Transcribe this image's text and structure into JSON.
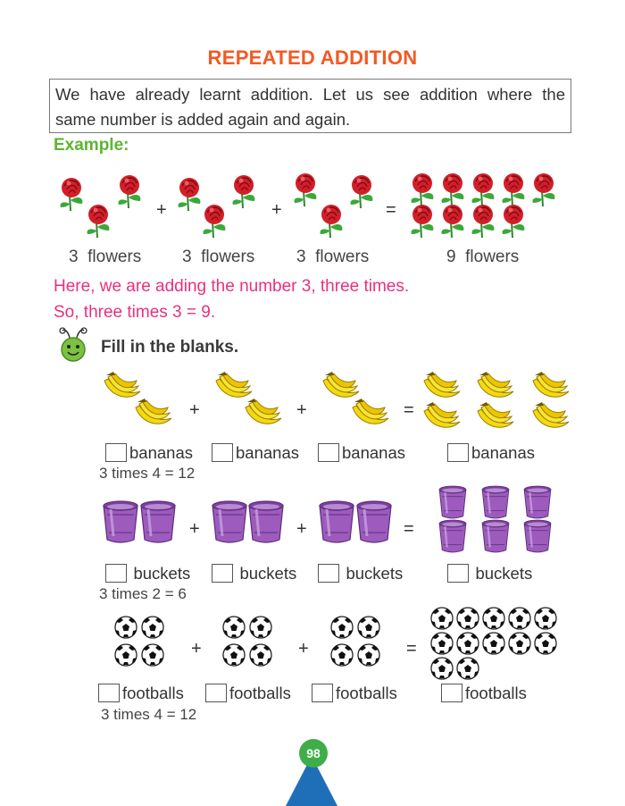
{
  "title": "REPEATED ADDITION",
  "intro_line1": "We have already learnt addition. Let us see addition where the",
  "intro_line2": "same number is added again and again.",
  "example_label": "Example:",
  "example": {
    "captions": [
      "3  flowers",
      "3  flowers",
      "3  flowers",
      "9  flowers"
    ],
    "plus": "+",
    "equals": "="
  },
  "explanation_line1": "Here, we are adding the number 3, three times.",
  "explanation_line2": "So, three times 3 = 9.",
  "exercise_title": "Fill in the blanks.",
  "exercises": [
    {
      "item": "bananas",
      "equation": "3 times 4 = 12"
    },
    {
      "item": "buckets",
      "equation": "3 times 2 = 6"
    },
    {
      "item": "footballs",
      "equation": "3 times 4 = 12"
    }
  ],
  "page_number": "98",
  "colors": {
    "title": "#f15a24",
    "example": "#5cb531",
    "pink": "#e9307f",
    "page_circle": "#3fae49",
    "page_triangle": "#1f6fb8"
  }
}
